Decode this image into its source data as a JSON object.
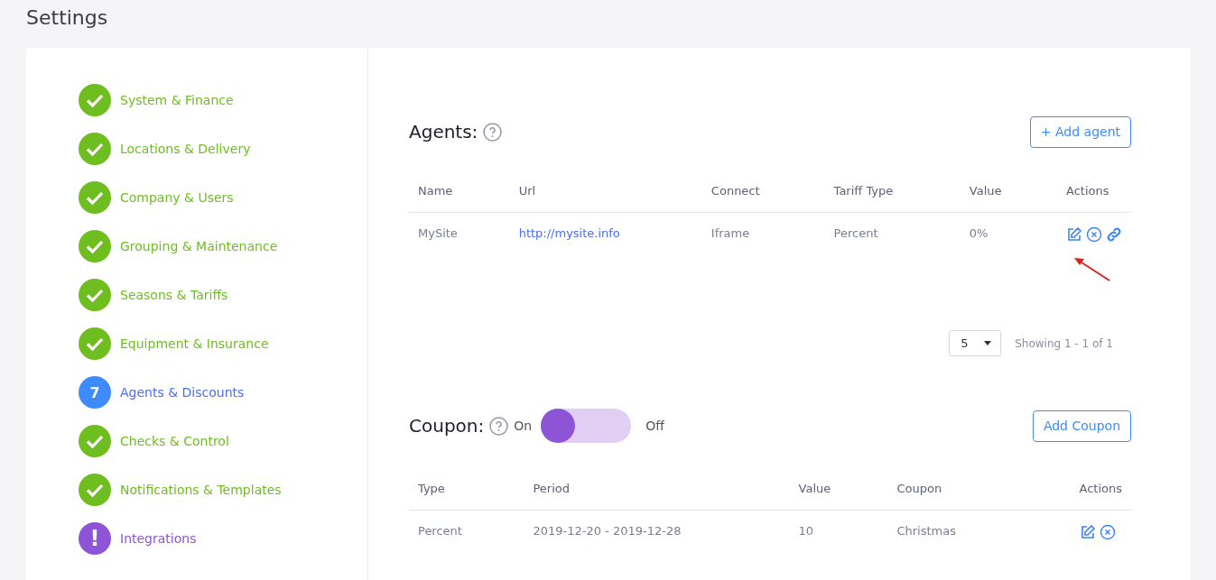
{
  "page_title": "Settings",
  "steps": [
    {
      "label": "System & Finance",
      "kind": "done"
    },
    {
      "label": "Locations & Delivery",
      "kind": "done"
    },
    {
      "label": "Company & Users",
      "kind": "done"
    },
    {
      "label": "Grouping & Maintenance",
      "kind": "done"
    },
    {
      "label": "Seasons & Tariffs",
      "kind": "done"
    },
    {
      "label": "Equipment & Insurance",
      "kind": "done"
    },
    {
      "label": "Agents & Discounts",
      "kind": "current",
      "badge": "7"
    },
    {
      "label": "Checks & Control",
      "kind": "done"
    },
    {
      "label": "Notifications & Templates",
      "kind": "done"
    },
    {
      "label": "Integrations",
      "kind": "warning",
      "badge": "!"
    }
  ],
  "agents": {
    "title": "Agents:",
    "button": "+ Add agent",
    "columns": [
      "Name",
      "Url",
      "Connect",
      "Tariff Type",
      "Value",
      "Actions"
    ],
    "rows": [
      {
        "cells": [
          "MySite",
          "http://mysite.info",
          "Iframe",
          "Percent",
          "0%"
        ],
        "actions": [
          {
            "kind": "edit"
          },
          {
            "kind": "remove"
          },
          {
            "kind": "link"
          }
        ]
      }
    ],
    "page_size": "5",
    "showing": "Showing 1 - 1 of 1"
  },
  "coupon": {
    "title": "Coupon:",
    "toggle": {
      "on_label": "On",
      "off_label": "Off",
      "on": false
    },
    "button": "Add Coupon",
    "columns": [
      "Type",
      "Period",
      "Value",
      "Coupon",
      "Actions"
    ],
    "rows": [
      {
        "cells": [
          "Percent",
          "2019-12-20 - 2019-12-28",
          "10",
          "Christmas"
        ],
        "actions": [
          {
            "kind": "edit"
          },
          {
            "kind": "remove"
          }
        ]
      }
    ]
  }
}
